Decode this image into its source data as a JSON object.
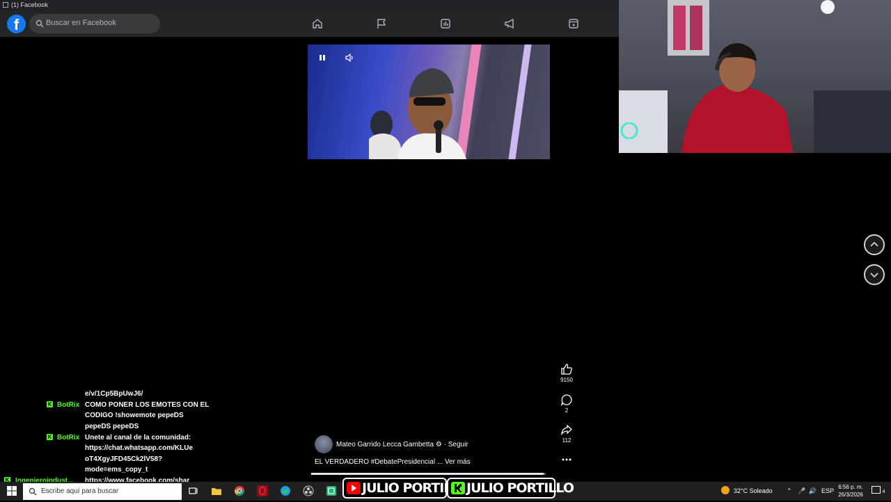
{
  "window": {
    "title": "(1) Facebook"
  },
  "facebook": {
    "logo": "f",
    "search_placeholder": "Buscar en Facebook",
    "nav_icons": [
      "home-icon",
      "pages-flag-icon",
      "stats-icon",
      "megaphone-icon",
      "video-icon"
    ]
  },
  "reel": {
    "author_name": "Mateo Garrido Lecca Gambetta",
    "follow_label": "· Seguir",
    "caption": "EL VERDADERO #DebatePresidencial ...",
    "see_more": "Ver más",
    "likes": "9150",
    "comments": "2",
    "shares": "112",
    "progress": 0.99
  },
  "chat": {
    "lines": [
      {
        "user": "",
        "text": "e/v/1Cp5BpUwJ6/"
      },
      {
        "user": "BotRix",
        "text": "COMO PONER LOS EMOTES CON EL"
      },
      {
        "user": "",
        "text": "CODIGO !showemote pepeDS"
      },
      {
        "user": "",
        "text": "pepeDS pepeDS"
      },
      {
        "user": "BotRix",
        "text": "Unete al canal de la comunidad:"
      },
      {
        "user": "",
        "text": "https://chat.whatsapp.com/KLUe"
      },
      {
        "user": "",
        "text": "oT4XgyJFD45Ck2lV58?"
      },
      {
        "user": "",
        "text": "mode=ems_copy_t"
      },
      {
        "user": "Ingenieroindust...",
        "text": "https://www.facebook.com/shar"
      }
    ]
  },
  "banner": {
    "left": "JULIO PORTILLO",
    "right": "JULIO PORTILLO"
  },
  "taskbar": {
    "search_placeholder": "Escribe aquí para buscar",
    "weather": "32°C  Soleado",
    "language": "ESP",
    "time": "6:56 p. m.",
    "date": "26/3/2026",
    "notifications": "4"
  },
  "colors": {
    "kick_green": "#53fc18",
    "fb_blue": "#1877f2",
    "youtube_red": "#ff0000"
  }
}
